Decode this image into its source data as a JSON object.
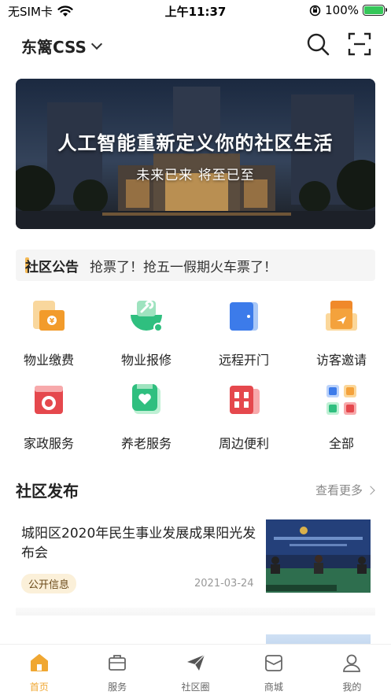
{
  "status_bar": {
    "carrier": "无SIM卡",
    "time": "上午11:37",
    "battery": "100%"
  },
  "header": {
    "location": "东篱CSS"
  },
  "banner": {
    "title": "人工智能重新定义你的社区生活",
    "subtitle": "未来已来  将至已至"
  },
  "notice": {
    "tag": "社区公告",
    "text": "抢票了！抢五一假期火车票了！"
  },
  "services": [
    {
      "label": "物业缴费",
      "icon": "wallet-icon"
    },
    {
      "label": "物业报修",
      "icon": "repair-icon"
    },
    {
      "label": "远程开门",
      "icon": "door-icon"
    },
    {
      "label": "访客邀请",
      "icon": "visitor-icon"
    },
    {
      "label": "家政服务",
      "icon": "washer-icon"
    },
    {
      "label": "养老服务",
      "icon": "elderly-care-icon"
    },
    {
      "label": "周边便利",
      "icon": "store-icon"
    },
    {
      "label": "全部",
      "icon": "all-icon"
    }
  ],
  "section": {
    "title": "社区发布",
    "more": "查看更多"
  },
  "news": [
    {
      "title": "城阳区2020年民生事业发展成果阳光发布会",
      "tag": "公开信息",
      "date": "2021-03-24"
    }
  ],
  "tabbar": [
    {
      "label": "首页",
      "icon": "home-icon",
      "active": true
    },
    {
      "label": "服务",
      "icon": "briefcase-icon",
      "active": false
    },
    {
      "label": "社区圈",
      "icon": "paper-plane-icon",
      "active": false
    },
    {
      "label": "商城",
      "icon": "mall-icon",
      "active": false
    },
    {
      "label": "我的",
      "icon": "user-icon",
      "active": false
    }
  ],
  "colors": {
    "accent": "#f0a732",
    "notice_bar": "#f4b244"
  }
}
